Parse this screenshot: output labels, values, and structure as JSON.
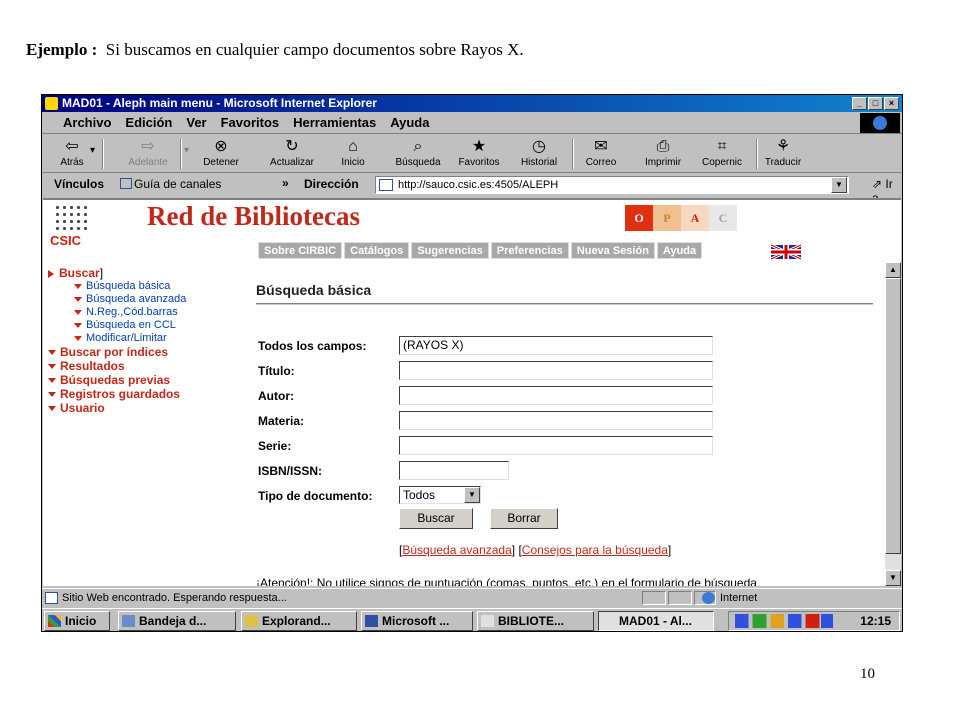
{
  "caption": {
    "prefix": "Ejemplo :",
    "text": "Si buscamos en cualquier campo documentos sobre Rayos X."
  },
  "page_number": "10",
  "window": {
    "title": "MAD01 - Aleph main menu - Microsoft Internet Explorer",
    "controls": [
      "_",
      "□",
      "×"
    ]
  },
  "menu": [
    "Archivo",
    "Edición",
    "Ver",
    "Favoritos",
    "Herramientas",
    "Ayuda"
  ],
  "toolbar": [
    {
      "label": "Atrás",
      "icon": "back-arrow-icon",
      "glyph": "⇦",
      "disabled": false
    },
    {
      "label": "Adelante",
      "icon": "forward-arrow-icon",
      "glyph": "⇨",
      "disabled": true
    },
    {
      "label": "Detener",
      "icon": "stop-icon",
      "glyph": "⊗",
      "disabled": false
    },
    {
      "label": "Actualizar",
      "icon": "refresh-icon",
      "glyph": "↻",
      "disabled": false
    },
    {
      "label": "Inicio",
      "icon": "home-icon",
      "glyph": "⌂",
      "disabled": false
    },
    {
      "label": "Búsqueda",
      "icon": "search-icon",
      "glyph": "⌕",
      "disabled": false
    },
    {
      "label": "Favoritos",
      "icon": "favorites-icon",
      "glyph": "★",
      "disabled": false
    },
    {
      "label": "Historial",
      "icon": "history-icon",
      "glyph": "◷",
      "disabled": false
    },
    {
      "label": "Correo",
      "icon": "mail-icon",
      "glyph": "✉",
      "disabled": false
    },
    {
      "label": "Imprimir",
      "icon": "print-icon",
      "glyph": "⎙",
      "disabled": false
    },
    {
      "label": "Copernic",
      "icon": "copernic-icon",
      "glyph": "⌗",
      "disabled": false
    },
    {
      "label": "Traducir",
      "icon": "translate-icon",
      "glyph": "⚘",
      "disabled": false
    }
  ],
  "links_bar": {
    "label": "Vínculos",
    "link": "Guía de canales",
    "more": "»",
    "address_label": "Dirección",
    "url": "http://sauco.csic.es:4505/ALEPH",
    "go": "Ir a"
  },
  "site": {
    "logo_text": "CSIC",
    "brand": "Red de Bibliotecas",
    "opac_letters": [
      {
        "letter": "O",
        "bg": "#e03010",
        "fg": "#ffffff"
      },
      {
        "letter": "P",
        "bg": "#f0c090",
        "fg": "#d08030"
      },
      {
        "letter": "A",
        "bg": "#f8d8c0",
        "fg": "#d02010"
      },
      {
        "letter": "C",
        "bg": "#e8e8e8",
        "fg": "#a0a0a0"
      }
    ],
    "tabs": [
      "Sobre CIRBIC",
      "Catálogos",
      "Sugerencias",
      "Preferencias",
      "Nueva Sesión",
      "Ayuda"
    ]
  },
  "sidebar": {
    "buscar": "Buscar",
    "buscar_sub": [
      "Búsqueda básica",
      "Búsqueda avanzada",
      "N.Reg.,Cód.barras",
      "Búsqueda en CCL",
      "Modificar/Limitar"
    ],
    "others": [
      "Buscar por índices",
      "Resultados",
      "Búsquedas previas",
      "Registros guardados",
      "Usuario"
    ]
  },
  "form": {
    "title": "Búsqueda básica",
    "fields": [
      {
        "label": "Todos los campos:",
        "value": "(RAYOS X)"
      },
      {
        "label": "Título:",
        "value": ""
      },
      {
        "label": "Autor:",
        "value": ""
      },
      {
        "label": "Materia:",
        "value": ""
      },
      {
        "label": "Serie:",
        "value": ""
      },
      {
        "label": "ISBN/ISSN:",
        "value": ""
      }
    ],
    "doc_type_label": "Tipo de documento:",
    "doc_type_value": "Todos",
    "search_button": "Buscar",
    "clear_button": "Borrar",
    "advanced_link": "Búsqueda avanzada",
    "tips_link": "Consejos para la búsqueda",
    "notice": "¡Atención!: No utilice signos de puntuación (comas, puntos, etc.) en el formulario de búsqueda."
  },
  "status": {
    "message": "Sitio Web encontrado. Esperando respuesta...",
    "zone": "Internet"
  },
  "taskbar": {
    "start": "Inicio",
    "items": [
      "Bandeja d...",
      "Explorand...",
      "Microsoft ...",
      "BIBLIOTE...",
      "MAD01 - Al..."
    ],
    "clock": "12:15"
  },
  "colors": {
    "brand_red": "#c0281a",
    "tab_gray": "#a8a8a8",
    "title_blue": "#000080"
  }
}
